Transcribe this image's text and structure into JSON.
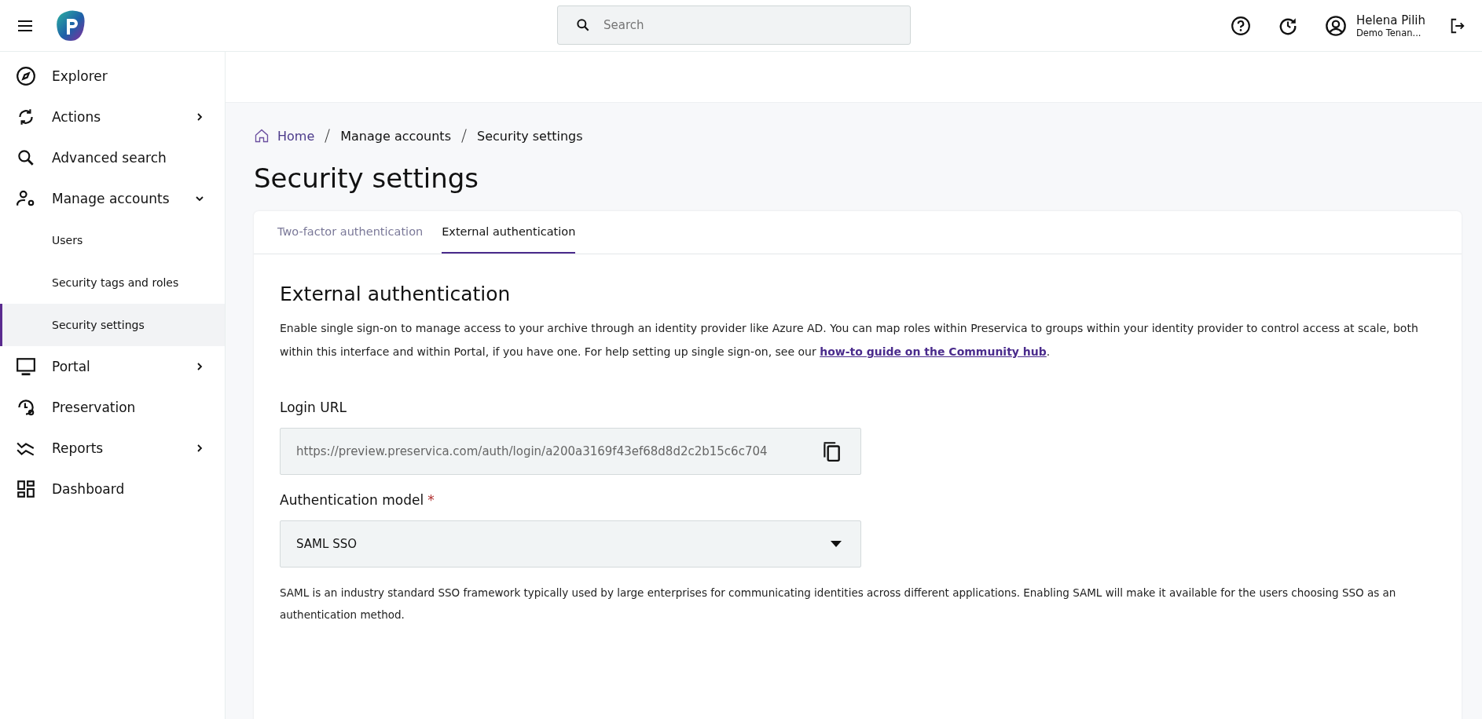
{
  "header": {
    "search": {
      "placeholder": "Search"
    },
    "user": {
      "name": "Helena Pilih",
      "tenant": "Demo Tenan..."
    }
  },
  "sidebar": {
    "items": [
      {
        "label": "Explorer",
        "kind": "link"
      },
      {
        "label": "Actions",
        "kind": "group",
        "expanded": false
      },
      {
        "label": "Advanced search",
        "kind": "link"
      },
      {
        "label": "Manage accounts",
        "kind": "group",
        "expanded": true,
        "children": [
          {
            "label": "Users",
            "selected": false
          },
          {
            "label": "Security tags and roles",
            "selected": false
          },
          {
            "label": "Security settings",
            "selected": true
          }
        ]
      },
      {
        "label": "Portal",
        "kind": "group",
        "expanded": false
      },
      {
        "label": "Preservation",
        "kind": "link"
      },
      {
        "label": "Reports",
        "kind": "group",
        "expanded": false
      },
      {
        "label": "Dashboard",
        "kind": "link"
      }
    ]
  },
  "breadcrumb": [
    "Home",
    "Manage accounts",
    "Security settings"
  ],
  "page_title": "Security settings",
  "tabs": [
    {
      "label": "Two-factor authentication",
      "selected": false
    },
    {
      "label": "External authentication",
      "selected": true
    }
  ],
  "section": {
    "title": "External authentication",
    "description": {
      "text": "Enable single sign-on to manage access to your archive through an identity provider like Azure AD. You can map roles within Preservica to groups within your identity provider to control access at scale, both within this interface and within Portal, if you have one. For help setting up single sign-on, see our ",
      "link": "how-to guide on the Community hub",
      "after": "."
    },
    "login_url": {
      "label": "Login URL",
      "value": "https://preview.preservica.com/auth/login/a200a3169f43ef68d8d2c2b15c6c704"
    },
    "auth_model": {
      "label": "Authentication model",
      "required": true,
      "required_mark": "*",
      "value": "SAML SSO"
    },
    "help": "SAML is an industry standard SSO framework typically used by large enterprises for communicating identities across different applications. Enabling SAML will make it available for the users choosing SSO as an authentication method."
  }
}
